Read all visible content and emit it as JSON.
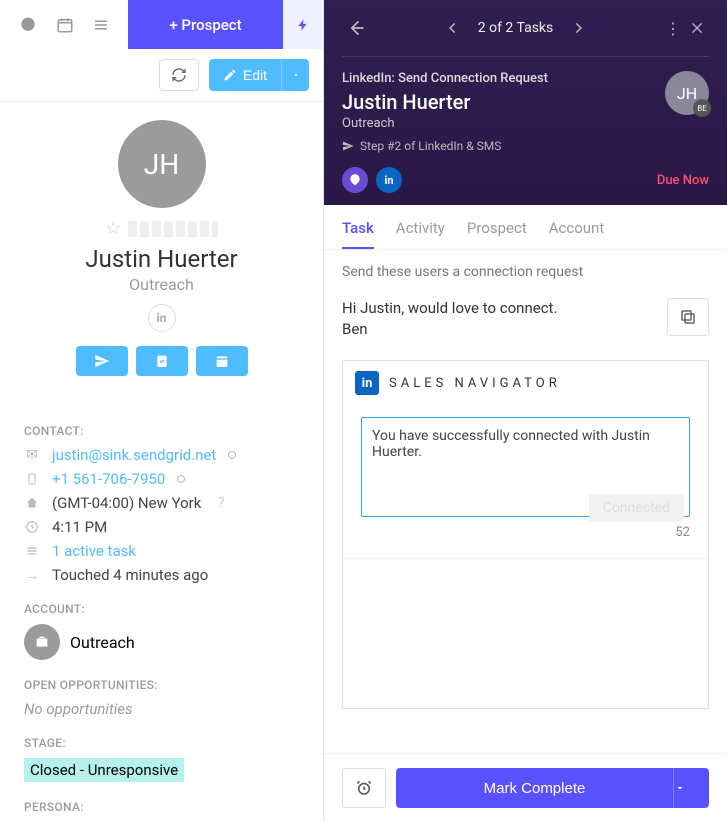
{
  "topbar": {
    "prospect_label": "+ Prospect"
  },
  "subbar": {
    "edit_label": "Edit"
  },
  "profile": {
    "initials": "JH",
    "name": "Justin Huerter",
    "company": "Outreach"
  },
  "contact": {
    "label": "CONTACT:",
    "email": "justin@sink.sendgrid.net",
    "phone": "+1 561-706-7950",
    "timezone": "(GMT-04:00) New York",
    "time": "4:11 PM",
    "tasks": "1 active task",
    "touched": "Touched 4 minutes ago"
  },
  "account": {
    "label": "ACCOUNT:",
    "name": "Outreach"
  },
  "opps": {
    "label": "OPEN OPPORTUNITIES:",
    "none": "No opportunities"
  },
  "stage": {
    "label": "STAGE:",
    "value": "Closed - Unresponsive"
  },
  "persona": {
    "label": "PERSONA:"
  },
  "rhead": {
    "counter": "2 of 2 Tasks",
    "task_type": "LinkedIn: Send Connection Request",
    "person": "Justin Huerter",
    "company": "Outreach",
    "step": "Step #2 of LinkedIn & SMS",
    "initials": "JH",
    "badge": "BE",
    "due": "Due Now"
  },
  "tabs": {
    "task": "Task",
    "activity": "Activity",
    "prospect": "Prospect",
    "account": "Account"
  },
  "body": {
    "instruction": "Send these users a connection request",
    "message_line1": "Hi Justin, would love to connect.",
    "message_line2": "Ben",
    "sn_title": "SALES NAVIGATOR",
    "sn_text": "You have successfully connected with Justin Huerter.",
    "sn_count": "52",
    "sn_connected": "Connected"
  },
  "footer": {
    "mark_label": "Mark Complete"
  }
}
